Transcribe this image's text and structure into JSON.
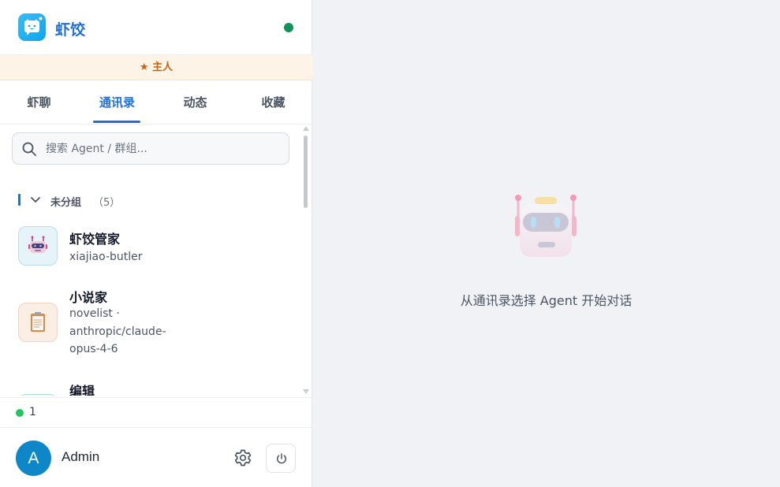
{
  "app": {
    "title": "虾饺"
  },
  "banner": {
    "role_label": "★ 主人"
  },
  "tabs": [
    {
      "label": "虾聊"
    },
    {
      "label": "通讯录"
    },
    {
      "label": "动态"
    },
    {
      "label": "收藏"
    }
  ],
  "active_tab": "通讯录",
  "search": {
    "placeholder": "搜索 Agent / 群组...",
    "value": ""
  },
  "group": {
    "label": "未分组",
    "count": "（5）"
  },
  "contacts": [
    {
      "name": "虾饺管家",
      "subtitle": "xiajiao-butler",
      "icon": "robot-icon"
    },
    {
      "name": "小说家",
      "subtitle": "novelist · anthropic/claude-opus-4-6",
      "icon": "clipboard-icon"
    },
    {
      "name": "编辑",
      "subtitle": "",
      "icon": ""
    }
  ],
  "status": {
    "online_count": "1",
    "color": "#22c55e"
  },
  "user": {
    "initial": "A",
    "name": "Admin"
  },
  "main": {
    "empty_message": "从通讯录选择 Agent 开始对话"
  },
  "colors": {
    "accent": "#1d6fe0",
    "online": "#10925a",
    "banner_bg": "#fdf3e6",
    "banner_text": "#c8620c",
    "avatar": "#0e87c9"
  }
}
